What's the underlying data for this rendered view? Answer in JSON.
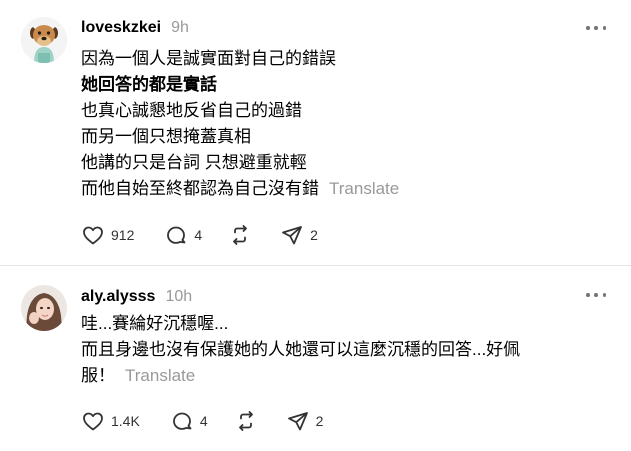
{
  "posts": [
    {
      "username": "loveskzkei",
      "time": "9h",
      "lines": [
        "因為一個人是誠實面對自己的錯誤",
        "她回答的都是實話",
        "也真心誠懇地反省自己的過錯",
        "而另一個只想掩蓋真相",
        "他講的只是台詞 只想避重就輕",
        "而他自始至終都認為自己沒有錯"
      ],
      "translate": "Translate",
      "likes": "912",
      "replies": "4",
      "reposts": "",
      "shares": "2",
      "avatar_icon": "dog-avatar-icon"
    },
    {
      "username": "aly.alysss",
      "time": "10h",
      "lines": [
        "哇...賽綸好沉穩喔...",
        "而且身邊也沒有保護她的人她還可以這麼沉穩的回答...好佩",
        "服！"
      ],
      "translate": "Translate",
      "likes": "1.4K",
      "replies": "4",
      "reposts": "",
      "shares": "2",
      "avatar_icon": "profile-photo-avatar"
    }
  ],
  "icons": {
    "like": "heart-icon",
    "reply": "comment-icon",
    "repost": "repost-icon",
    "share": "share-icon",
    "more": "more-icon"
  },
  "colors": {
    "text": "#000000",
    "muted": "#999999",
    "icon": "#333333",
    "divider": "#e5e5e5",
    "avatar_bg": "#f2f2f2"
  }
}
